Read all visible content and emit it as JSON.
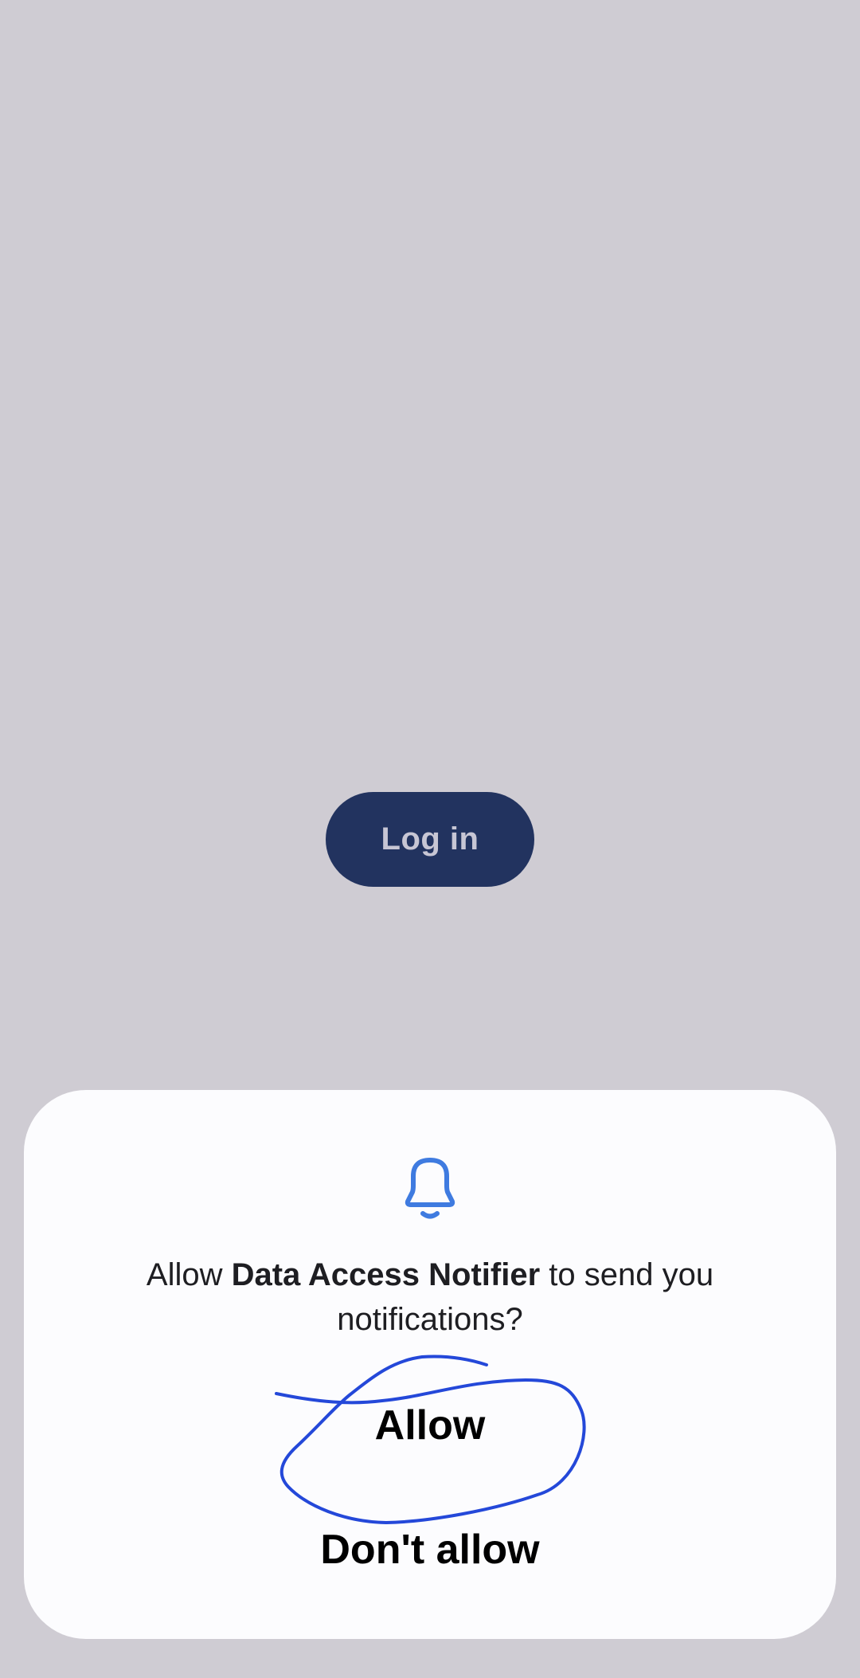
{
  "login": {
    "label": "Log in"
  },
  "dialog": {
    "icon": "bell-icon",
    "message_prefix": "Allow ",
    "app_name": "Data Access Notifier",
    "message_suffix": " to send you notifications?",
    "allow_label": "Allow",
    "deny_label": "Don't allow"
  },
  "annotation": {
    "color": "#2448d9",
    "target": "allow-button"
  },
  "colors": {
    "background": "#cfccd3",
    "login_button": "#22335f",
    "sheet": "#fcfcfe",
    "bell": "#3f7be0"
  }
}
